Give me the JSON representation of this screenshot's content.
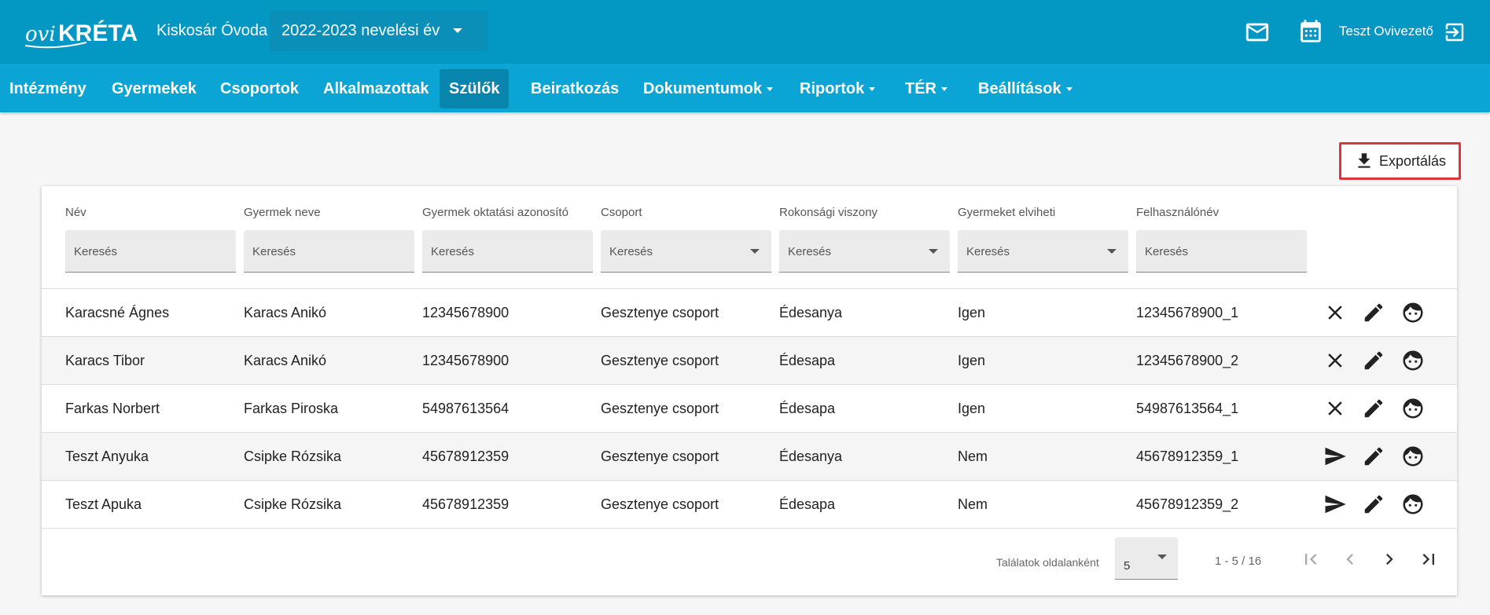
{
  "header": {
    "logo_text": "oviKRÉTA",
    "school": "Kiskosár Óvoda",
    "year": "2022-2023 nevelési év",
    "user": "Teszt Ovivezető"
  },
  "nav": [
    {
      "label": "Intézmény",
      "dropdown": false
    },
    {
      "label": "Gyermekek",
      "dropdown": false
    },
    {
      "label": "Csoportok",
      "dropdown": false
    },
    {
      "label": "Alkalmazottak",
      "dropdown": false
    },
    {
      "label": "Szülők",
      "dropdown": false,
      "active": true
    },
    {
      "label": "Beiratkozás",
      "dropdown": false
    },
    {
      "label": "Dokumentumok",
      "dropdown": true
    },
    {
      "label": "Riportok",
      "dropdown": true
    },
    {
      "label": "TÉR",
      "dropdown": true
    },
    {
      "label": "Beállítások",
      "dropdown": true
    }
  ],
  "export_label": "Exportálás",
  "columns": [
    {
      "label": "Név",
      "placeholder": "Keresés",
      "select": false
    },
    {
      "label": "Gyermek neve",
      "placeholder": "Keresés",
      "select": false
    },
    {
      "label": "Gyermek oktatási azonosító",
      "placeholder": "Keresés",
      "select": false
    },
    {
      "label": "Csoport",
      "placeholder": "Keresés",
      "select": true
    },
    {
      "label": "Rokonsági viszony",
      "placeholder": "Keresés",
      "select": true
    },
    {
      "label": "Gyermeket elviheti",
      "placeholder": "Keresés",
      "select": true
    },
    {
      "label": "Felhasználónév",
      "placeholder": "Keresés",
      "select": false
    }
  ],
  "rows": [
    {
      "cells": [
        "Karacsné Ágnes",
        "Karacs Anikó",
        "12345678900",
        "Gesztenye csoport",
        "Édesanya",
        "Igen",
        "12345678900_1"
      ],
      "first_action": "close-icon"
    },
    {
      "cells": [
        "Karacs Tibor",
        "Karacs Anikó",
        "12345678900",
        "Gesztenye csoport",
        "Édesapa",
        "Igen",
        "12345678900_2"
      ],
      "first_action": "close-icon"
    },
    {
      "cells": [
        "Farkas Norbert",
        "Farkas Piroska",
        "54987613564",
        "Gesztenye csoport",
        "Édesapa",
        "Igen",
        "54987613564_1"
      ],
      "first_action": "close-icon"
    },
    {
      "cells": [
        "Teszt Anyuka",
        "Csipke Rózsika",
        "45678912359",
        "Gesztenye csoport",
        "Édesanya",
        "Nem",
        "45678912359_1"
      ],
      "first_action": "send-icon"
    },
    {
      "cells": [
        "Teszt Apuka",
        "Csipke Rózsika",
        "45678912359",
        "Gesztenye csoport",
        "Édesapa",
        "Nem",
        "45678912359_2"
      ],
      "first_action": "send-icon"
    }
  ],
  "pagination": {
    "per_page_label": "Találatok oldalanként",
    "per_page": "5",
    "range": "1 - 5 / 16"
  },
  "colors": {
    "topbar": "#0397c4",
    "nav": "#0aa5d5",
    "nav_active": "#0785ad",
    "export_border": "#e53137"
  }
}
